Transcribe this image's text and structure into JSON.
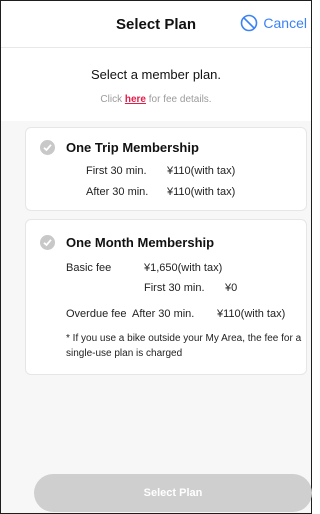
{
  "header": {
    "title": "Select Plan",
    "cancel_label": "Cancel"
  },
  "intro": {
    "title": "Select a member plan.",
    "link_prefix": "Click ",
    "link_text": "here",
    "link_suffix": " for fee details."
  },
  "plans": [
    {
      "name": "One Trip Membership",
      "rows": [
        {
          "label": "First 30 min.",
          "value": "¥110(with tax)"
        },
        {
          "label": "After 30 min.",
          "value": "¥110(with tax)"
        }
      ]
    },
    {
      "name": "One Month Membership",
      "basic_fee_label": "Basic fee",
      "basic_fee_value": "¥1,650(with tax)",
      "first_label": "First 30 min.",
      "first_value": "¥0",
      "overdue_label": "Overdue fee",
      "overdue_after_label": "After 30 min.",
      "overdue_value": "¥110(with tax)",
      "note": "* If you use a bike outside your My Area, the fee for a single-use plan is charged"
    }
  ],
  "footer": {
    "button_label": "Select Plan"
  },
  "colors": {
    "accent": "#3b82f6",
    "link": "#e11d48",
    "button_disabled": "#cfcfcf"
  }
}
